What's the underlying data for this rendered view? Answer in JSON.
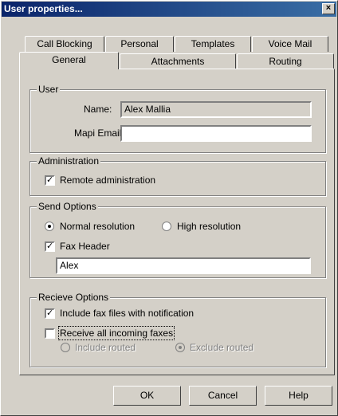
{
  "window": {
    "title": "User properties...",
    "close_glyph": "×"
  },
  "tabs": {
    "row1": [
      "Call Blocking",
      "Personal",
      "Templates",
      "Voice Mail"
    ],
    "row2": [
      "General",
      "Attachments",
      "Routing"
    ],
    "active": "General"
  },
  "user_group": {
    "legend": "User",
    "name_label": "Name:",
    "name_value": "Alex Mallia",
    "mapi_label": "Mapi Email:",
    "mapi_value": ""
  },
  "admin_group": {
    "legend": "Administration",
    "remote_admin_label": "Remote administration",
    "remote_admin_checked": true
  },
  "send_group": {
    "legend": "Send Options",
    "normal_label": "Normal resolution",
    "high_label": "High resolution",
    "selected": "Normal resolution",
    "fax_header_label": "Fax Header",
    "fax_header_checked": true,
    "fax_header_value": "Alex"
  },
  "receive_group": {
    "legend": "Recieve Options",
    "include_files_label": "Include fax files with notification",
    "include_files_checked": true,
    "receive_all_label": "Receive all incoming faxes",
    "receive_all_checked": false,
    "include_routed_label": "Include routed",
    "exclude_routed_label": "Exclude routed",
    "routed_selected": "Exclude routed"
  },
  "buttons": {
    "ok": "OK",
    "cancel": "Cancel",
    "help": "Help"
  }
}
